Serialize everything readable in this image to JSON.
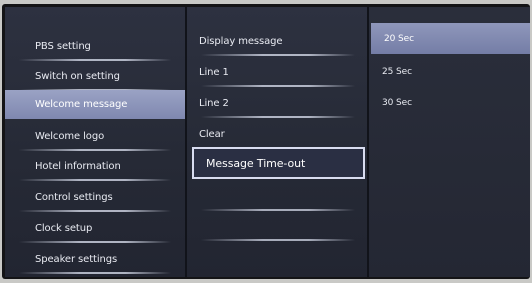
{
  "menu": {
    "items": [
      {
        "label": "PBS setting"
      },
      {
        "label": "Switch on setting"
      },
      {
        "label": "Welcome message",
        "active": true
      },
      {
        "label": "Welcome logo"
      },
      {
        "label": "Hotel information"
      },
      {
        "label": "Control settings"
      },
      {
        "label": "Clock setup"
      },
      {
        "label": "Speaker settings"
      }
    ]
  },
  "submenu": {
    "items": [
      {
        "label": "Display message"
      },
      {
        "label": "Line 1"
      },
      {
        "label": "Line 2"
      },
      {
        "label": "Clear"
      },
      {
        "label": "Message Time-out",
        "focused": true
      }
    ]
  },
  "options": {
    "items": [
      {
        "label": "20 Sec",
        "selected": true
      },
      {
        "label": "25 Sec"
      },
      {
        "label": "30 Sec"
      }
    ]
  },
  "colors": {
    "screen_bg": "#2a2e3b",
    "highlight": "#8a92b8",
    "focus_border": "#d8dcf0",
    "text": "#e9ebf2"
  }
}
